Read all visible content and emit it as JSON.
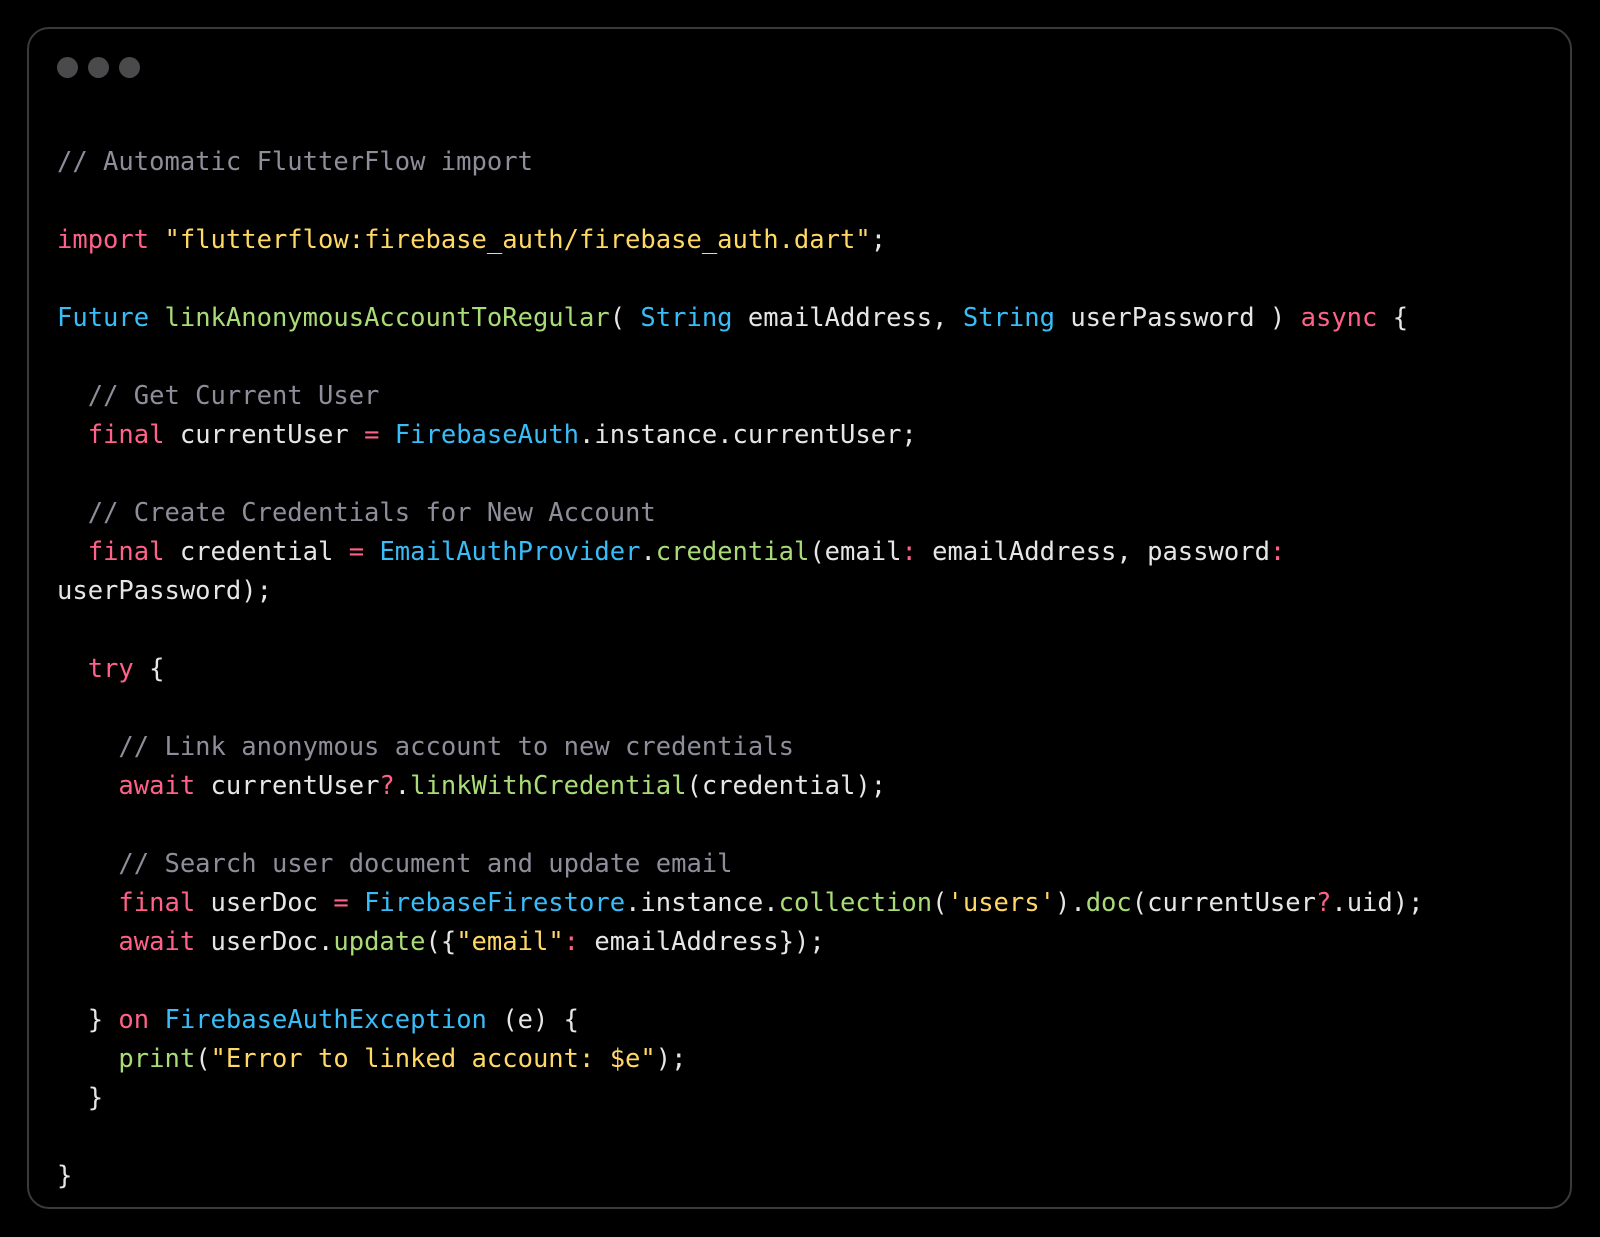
{
  "window": {
    "border_color": "#3a3a3c",
    "background": "#000000",
    "dots": [
      {
        "name": "close",
        "color": "#4a4a4c"
      },
      {
        "name": "minimize",
        "color": "#4a4a4c"
      },
      {
        "name": "maximize",
        "color": "#4a4a4c"
      }
    ]
  },
  "theme": {
    "plain": "#e6e6e6",
    "comment": "#8e8e9a",
    "keyword": "#ff6188",
    "type": "#38bdf8",
    "function": "#a9dc76",
    "string": "#ffd866"
  },
  "code": {
    "lines": [
      [
        [
          "comment",
          "// Automatic FlutterFlow import"
        ]
      ],
      [],
      [
        [
          "keyword",
          "import"
        ],
        [
          "plain",
          " "
        ],
        [
          "string",
          "\"flutterflow:firebase_auth/firebase_auth.dart\""
        ],
        [
          "plain",
          ";"
        ]
      ],
      [],
      [
        [
          "type",
          "Future"
        ],
        [
          "plain",
          " "
        ],
        [
          "function",
          "linkAnonymousAccountToRegular"
        ],
        [
          "plain",
          "( "
        ],
        [
          "type",
          "String"
        ],
        [
          "plain",
          " emailAddress, "
        ],
        [
          "type",
          "String"
        ],
        [
          "plain",
          " userPassword ) "
        ],
        [
          "keyword",
          "async"
        ],
        [
          "plain",
          " {"
        ]
      ],
      [],
      [
        [
          "plain",
          "  "
        ],
        [
          "comment",
          "// Get Current User"
        ]
      ],
      [
        [
          "plain",
          "  "
        ],
        [
          "keyword",
          "final"
        ],
        [
          "plain",
          " currentUser "
        ],
        [
          "keyword",
          "="
        ],
        [
          "plain",
          " "
        ],
        [
          "type",
          "FirebaseAuth"
        ],
        [
          "plain",
          ".instance.currentUser;"
        ]
      ],
      [],
      [
        [
          "plain",
          "  "
        ],
        [
          "comment",
          "// Create Credentials for New Account"
        ]
      ],
      [
        [
          "plain",
          "  "
        ],
        [
          "keyword",
          "final"
        ],
        [
          "plain",
          " credential "
        ],
        [
          "keyword",
          "="
        ],
        [
          "plain",
          " "
        ],
        [
          "type",
          "EmailAuthProvider"
        ],
        [
          "plain",
          "."
        ],
        [
          "function",
          "credential"
        ],
        [
          "plain",
          "(email"
        ],
        [
          "keyword",
          ":"
        ],
        [
          "plain",
          " emailAddress, password"
        ],
        [
          "keyword",
          ":"
        ]
      ],
      [
        [
          "plain",
          "userPassword);"
        ]
      ],
      [],
      [
        [
          "plain",
          "  "
        ],
        [
          "keyword",
          "try"
        ],
        [
          "plain",
          " {"
        ]
      ],
      [],
      [
        [
          "plain",
          "    "
        ],
        [
          "comment",
          "// Link anonymous account to new credentials"
        ]
      ],
      [
        [
          "plain",
          "    "
        ],
        [
          "keyword",
          "await"
        ],
        [
          "plain",
          " currentUser"
        ],
        [
          "keyword",
          "?"
        ],
        [
          "plain",
          "."
        ],
        [
          "function",
          "linkWithCredential"
        ],
        [
          "plain",
          "(credential);"
        ]
      ],
      [],
      [
        [
          "plain",
          "    "
        ],
        [
          "comment",
          "// Search user document and update email"
        ]
      ],
      [
        [
          "plain",
          "    "
        ],
        [
          "keyword",
          "final"
        ],
        [
          "plain",
          " userDoc "
        ],
        [
          "keyword",
          "="
        ],
        [
          "plain",
          " "
        ],
        [
          "type",
          "FirebaseFirestore"
        ],
        [
          "plain",
          ".instance."
        ],
        [
          "function",
          "collection"
        ],
        [
          "plain",
          "("
        ],
        [
          "string",
          "'users'"
        ],
        [
          "plain",
          ")."
        ],
        [
          "function",
          "doc"
        ],
        [
          "plain",
          "(currentUser"
        ],
        [
          "keyword",
          "?"
        ],
        [
          "plain",
          ".uid);"
        ]
      ],
      [
        [
          "plain",
          "    "
        ],
        [
          "keyword",
          "await"
        ],
        [
          "plain",
          " userDoc."
        ],
        [
          "function",
          "update"
        ],
        [
          "plain",
          "({"
        ],
        [
          "string",
          "\"email\""
        ],
        [
          "keyword",
          ":"
        ],
        [
          "plain",
          " emailAddress});"
        ]
      ],
      [],
      [
        [
          "plain",
          "  } "
        ],
        [
          "keyword",
          "on"
        ],
        [
          "plain",
          " "
        ],
        [
          "type",
          "FirebaseAuthException"
        ],
        [
          "plain",
          " (e) {"
        ]
      ],
      [
        [
          "plain",
          "    "
        ],
        [
          "function",
          "print"
        ],
        [
          "plain",
          "("
        ],
        [
          "string",
          "\"Error to linked account: $e\""
        ],
        [
          "plain",
          ");"
        ]
      ],
      [
        [
          "plain",
          "  }"
        ]
      ],
      [],
      [
        [
          "plain",
          "}"
        ]
      ]
    ]
  }
}
